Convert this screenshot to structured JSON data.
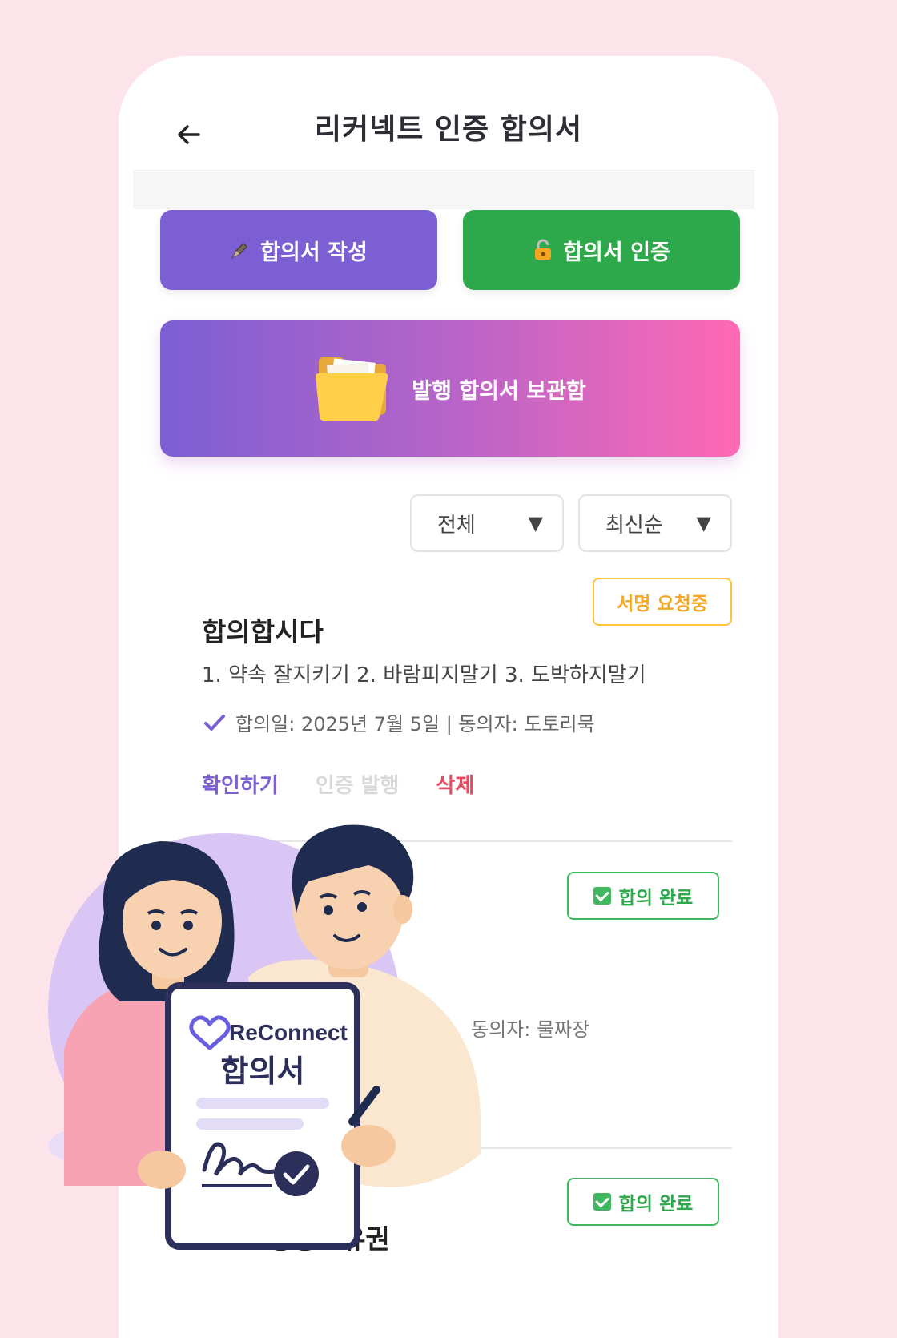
{
  "header": {
    "title": "리커넥트 인증 합의서"
  },
  "actions": {
    "write_label": "합의서 작성",
    "write_icon": "pen-icon",
    "cert_label": "합의서 인증",
    "cert_icon": "lock-icon",
    "archive_label": "발행 합의서 보관함",
    "archive_icon": "folder-icon"
  },
  "filters": {
    "status_selected": "전체",
    "sort_selected": "최신순"
  },
  "agreements": [
    {
      "status": "서명 요청중",
      "title": "합의합시다",
      "content": "1. 약속 잘지키기 2. 바람피지말기 3. 도박하지말기",
      "meta": "합의일: 2025년 7월 5일 | 동의자: 도토리묵",
      "view_label": "확인하기",
      "issue_label": "인증 발행",
      "delete_label": "삭제"
    },
    {
      "status": "합의 완료",
      "meta_partial": "동의자: 물짜장"
    },
    {
      "status": "합의 완료",
      "title": "K35 공동소유권"
    }
  ],
  "illustration": {
    "brand": "ReConnect",
    "doc_title": "합의서"
  },
  "colors": {
    "background": "#fde4ea",
    "purple": "#7b5fd3",
    "green": "#2da84a",
    "pink": "#ff69b4",
    "orange": "#f5a623",
    "red": "#e84a5f"
  }
}
